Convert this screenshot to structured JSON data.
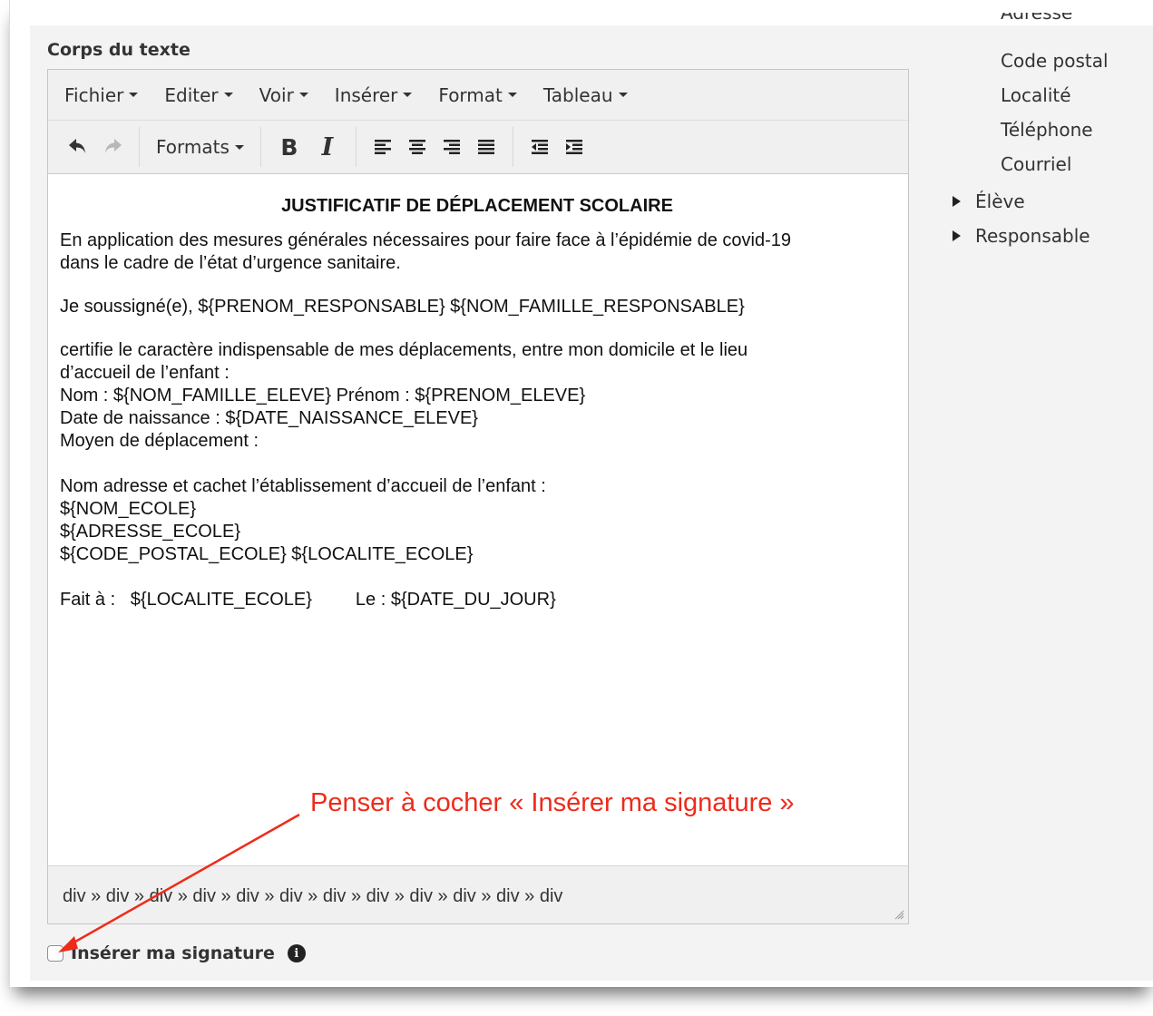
{
  "section_title": "Corps du texte",
  "menubar": [
    "Fichier",
    "Editer",
    "Voir",
    "Insérer",
    "Format",
    "Tableau"
  ],
  "toolbar": {
    "undo_icon": "undo-icon",
    "redo_icon": "redo-icon",
    "formats_label": "Formats",
    "bold_label": "B",
    "italic_label": "I",
    "align_icons": [
      "align-left-icon",
      "align-center-icon",
      "align-right-icon",
      "align-justify-icon"
    ],
    "indent_icons": [
      "outdent-icon",
      "indent-icon"
    ]
  },
  "document": {
    "title": "JUSTIFICATIF DE DÉPLACEMENT SCOLAIRE",
    "intro_line1": "En application des mesures générales nécessaires pour faire face à l’épidémie de covid-19",
    "intro_line2": "dans le cadre de l’état d’urgence sanitaire.",
    "undersigned": "Je soussigné(e), ${PRENOM_RESPONSABLE} ${NOM_FAMILLE_RESPONSABLE}",
    "certify_line1": "certifie le caractère indispensable de mes déplacements, entre mon domicile et le lieu",
    "certify_line2": "d’accueil de l’enfant :",
    "name_line": "Nom : ${NOM_FAMILLE_ELEVE} Prénom : ${PRENOM_ELEVE}",
    "birth_line": "Date de naissance : ${DATE_NAISSANCE_ELEVE}",
    "transport_line": "Moyen de déplacement :",
    "school_header": "Nom adresse et cachet l’établissement d’accueil de l’enfant :",
    "school_name": "${NOM_ECOLE}",
    "school_address": "${ADRESSE_ECOLE}",
    "school_city": "${CODE_POSTAL_ECOLE} ${LOCALITE_ECOLE}",
    "done_at": "Fait à :   ${LOCALITE_ECOLE}",
    "date": "Le : ${DATE_DU_JOUR}"
  },
  "status_path": "div » div » div » div » div » div » div » div » div » div » div » div",
  "signature": {
    "label": "Insérer ma signature",
    "checked": false,
    "info_icon": "info-circle-icon"
  },
  "sidebar": {
    "cut_item": "Adresse",
    "items": [
      "Code postal",
      "Localité",
      "Téléphone",
      "Courriel"
    ],
    "tree": [
      "Élève",
      "Responsable"
    ]
  },
  "annotation": {
    "text": "Penser à cocher « Insérer ma signature »",
    "color": "#ee2b1a"
  }
}
